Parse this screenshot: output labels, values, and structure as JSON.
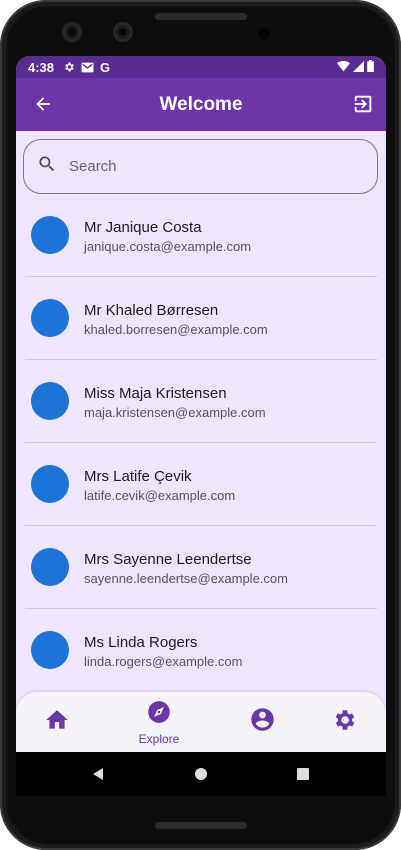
{
  "status_bar": {
    "time": "4:38",
    "icons": [
      "gear-icon",
      "mail-icon",
      "google-icon",
      "wifi-icon",
      "signal-icon",
      "battery-icon"
    ],
    "google_glyph": "G"
  },
  "app_bar": {
    "title": "Welcome",
    "back_icon": "arrow-back-icon",
    "logout_icon": "logout-icon",
    "color": "#6c35a8"
  },
  "search": {
    "placeholder": "Search"
  },
  "users": [
    {
      "name": "Mr Janique Costa",
      "email": "janique.costa@example.com"
    },
    {
      "name": "Mr Khaled Børresen",
      "email": "khaled.borresen@example.com"
    },
    {
      "name": "Miss Maja Kristensen",
      "email": "maja.kristensen@example.com"
    },
    {
      "name": "Mrs Latife Çevik",
      "email": "latife.cevik@example.com"
    },
    {
      "name": "Mrs Sayenne Leendertse",
      "email": "sayenne.leendertse@example.com"
    },
    {
      "name": "Ms Linda Rogers",
      "email": "linda.rogers@example.com"
    }
  ],
  "bottom_nav": {
    "items": [
      {
        "icon": "home-icon",
        "label": ""
      },
      {
        "icon": "compass-icon",
        "label": "Explore",
        "selected": true
      },
      {
        "icon": "account-circle-icon",
        "label": ""
      },
      {
        "icon": "settings-icon",
        "label": ""
      }
    ]
  },
  "colors": {
    "background": "#efe6fd",
    "avatar": "#1d73d6",
    "accent": "#6c35a8",
    "status_bar": "#5a2b91"
  }
}
